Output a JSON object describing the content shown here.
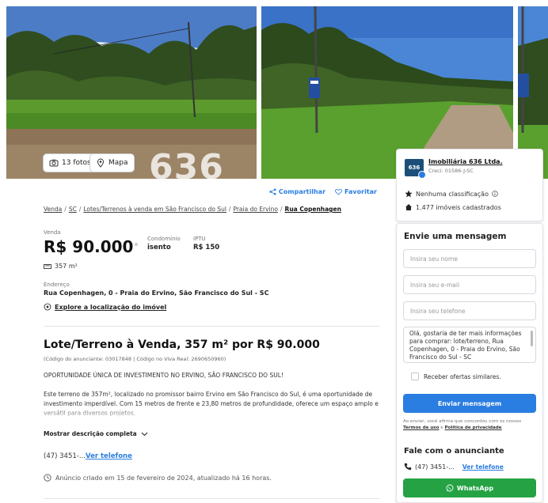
{
  "gallery": {
    "photos_label": "13 fotos",
    "map_label": "Mapa",
    "watermark": "636"
  },
  "actions": {
    "share": "Compartilhar",
    "favorite": "Favoritar"
  },
  "breadcrumb": [
    "Venda",
    "SC",
    "Lotes/Terrenos à venda em São Francisco do Sul",
    "Praia do Ervino",
    "Rua Copenhagen"
  ],
  "listing": {
    "price_label": "Venda",
    "price": "R$ 90.000",
    "condo_label": "Condomínio",
    "condo_value": "isento",
    "iptu_label": "IPTU",
    "iptu_value": "R$ 150",
    "area": "357 m²",
    "address_label": "Endereço",
    "address": "Rua Copenhagen, 0 - Praia do Ervino, São Francisco do Sul - SC",
    "explore": "Explore a localização do imóvel",
    "title": "Lote/Terreno à Venda, 357 m² por R$ 90.000",
    "codes": "(Código do anunciante: 03017848 | Código no Viva Real: 2690650960)",
    "desc_headline": "OPORTUNIDADE ÚNICA DE INVESTIMENTO NO ERVINO, SÃO FRANCISCO DO SUL!",
    "desc_body": "Este terreno de 357m², localizado no promissor bairro Ervino em São Francisco do Sul, é uma oportunidade de investimento imperdível. Com 15 metros de frente e 23,80 metros de profundidade, oferece um espaço amplo e versátil para diversos projetos.",
    "show_more": "Mostrar descrição completa",
    "phone_prefix": "(47) 3451-...",
    "phone_link": "Ver telefone",
    "created": "Anúncio criado em 15 de fevereiro de 2024, atualizado há 16 horas."
  },
  "agency": {
    "logo": "636",
    "name": "Imobiliária 636 Ltda.",
    "creci": "Creci: 01586-J-SC",
    "rating": "Nenhuma classificação",
    "count": "1.477 imóveis cadastrados"
  },
  "contact_form": {
    "title": "Envie uma mensagem",
    "name_placeholder": "Insira seu nome",
    "email_placeholder": "Insira seu e-mail",
    "phone_placeholder": "Insira seu telefone",
    "message": "Olá, gostaria de ter mais informações para comprar: lote/terreno, Rua Copenhagen, 0 - Praia do Ervino, São Francisco do Sul - SC",
    "similar_label": "Receber ofertas similares.",
    "send_label": "Enviar mensagem",
    "terms_prefix": "Ao enviar, você afirma que concordou com os nossos",
    "terms_link": "Termos de uso",
    "terms_and": "e",
    "privacy_link": "Política de privacidade",
    "contact_title": "Fale com o anunciante",
    "contact_phone": "(47) 3451-...",
    "contact_phone_link": "Ver telefone",
    "whatsapp_label": "WhatsApp"
  },
  "colors": {
    "accent": "#2a7de1",
    "whatsapp": "#25a244"
  }
}
